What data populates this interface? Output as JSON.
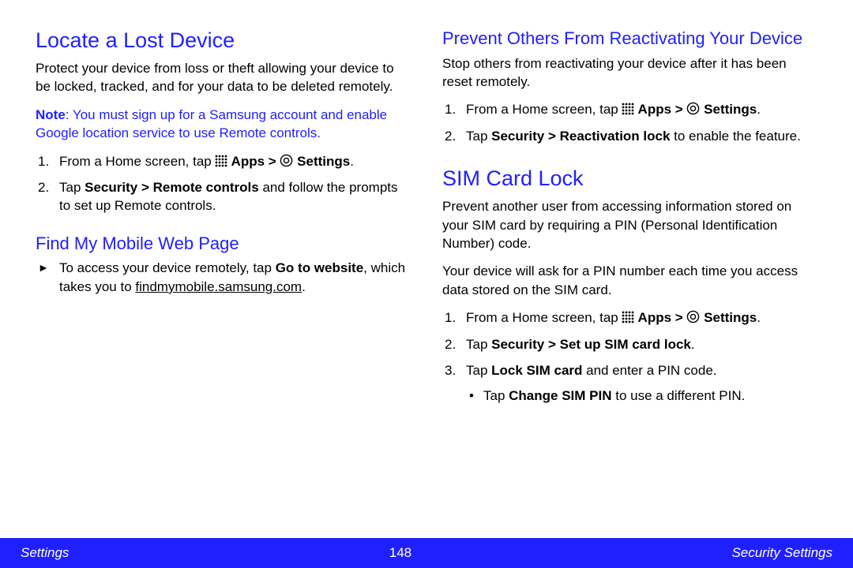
{
  "left": {
    "h1": "Locate a Lost Device",
    "intro": "Protect your device from loss or theft allowing your device to be locked, tracked, and for your data to be deleted remotely.",
    "note_bold": "Note",
    "note_rest": ": You must sign up for a Samsung account and enable Google location service to use Remote controls.",
    "step1_a": "From a Home screen, tap ",
    "step1_apps": " Apps > ",
    "step1_settings": " Settings",
    "step2_a": "Tap ",
    "step2_b": "Security > Remote controls",
    "step2_c": " and follow the prompts to set up Remote controls.",
    "h2": "Find My Mobile Web Page",
    "arrow_a": "To access your device remotely, tap ",
    "arrow_b": "Go to website",
    "arrow_c": ", which takes you to ",
    "arrow_link": "findmymobile.samsung.com",
    "arrow_d": "."
  },
  "right": {
    "h2a": "Prevent Others From Reactivating Your Device",
    "pr_intro": "Stop others from reactivating your device after it has been reset remotely.",
    "pr1_a": "From a Home screen, tap ",
    "pr1_apps": " Apps > ",
    "pr1_settings": " Settings",
    "pr2_a": "Tap ",
    "pr2_b": "Security > Reactivation lock",
    "pr2_c": " to enable the feature.",
    "h1b": "SIM Card Lock",
    "sim_p1": "Prevent another user from accessing information stored on your SIM card by requiring a PIN (Personal Identification Number) code.",
    "sim_p2": "Your device will ask for a PIN number each time you access data stored on the SIM card.",
    "sim1_a": "From a Home screen, tap ",
    "sim1_apps": " Apps > ",
    "sim1_settings": " Settings",
    "sim2_a": "Tap ",
    "sim2_b": "Security > Set up SIM card lock",
    "sim2_c": ".",
    "sim3_a": "Tap ",
    "sim3_b": "Lock SIM card",
    "sim3_c": " and enter a PIN code.",
    "sub_a": "Tap ",
    "sub_b": "Change SIM PIN",
    "sub_c": " to use a different PIN."
  },
  "footer": {
    "left": "Settings",
    "center": "148",
    "right": "Security Settings"
  }
}
